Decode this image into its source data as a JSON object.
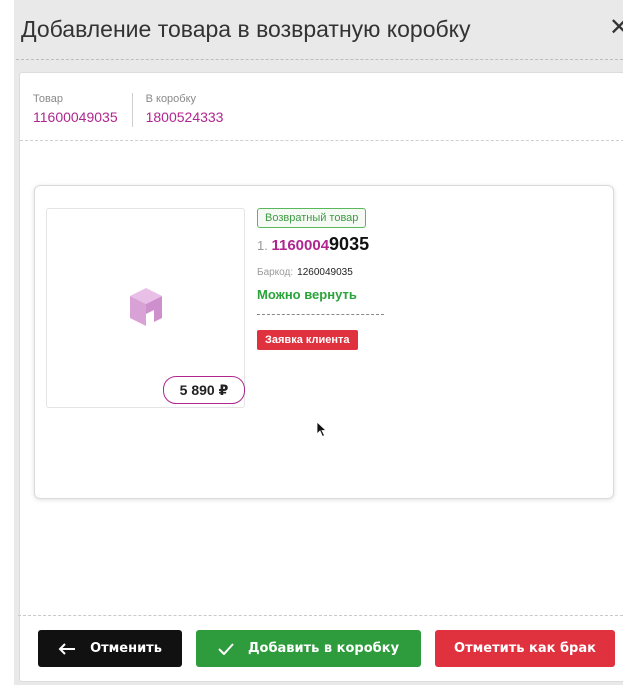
{
  "dialog": {
    "title": "Добавление товара в возвратную коробку",
    "close_glyph": "✕"
  },
  "info": {
    "product_label": "Товар",
    "product_value": "11600049035",
    "box_label": "В коробку",
    "box_value": "1800524333"
  },
  "item": {
    "image_icon": "cube-placeholder-icon",
    "price": "5 890 ₽",
    "return_tag": "Возвратный товар",
    "index": "1.",
    "article_prefix": "1160004",
    "article_suffix": "9035",
    "barcode_label": "Баркод:",
    "barcode_value": "1260049035",
    "status": "Можно вернуть",
    "claim_tag": "Заявка клиента"
  },
  "buttons": {
    "cancel": "Отменить",
    "add": "Добавить в коробку",
    "defect": "Отметить как брак"
  },
  "colors": {
    "accent": "#b0268f",
    "success": "#2e9b3c",
    "danger": "#e0313f",
    "dark": "#111111"
  }
}
